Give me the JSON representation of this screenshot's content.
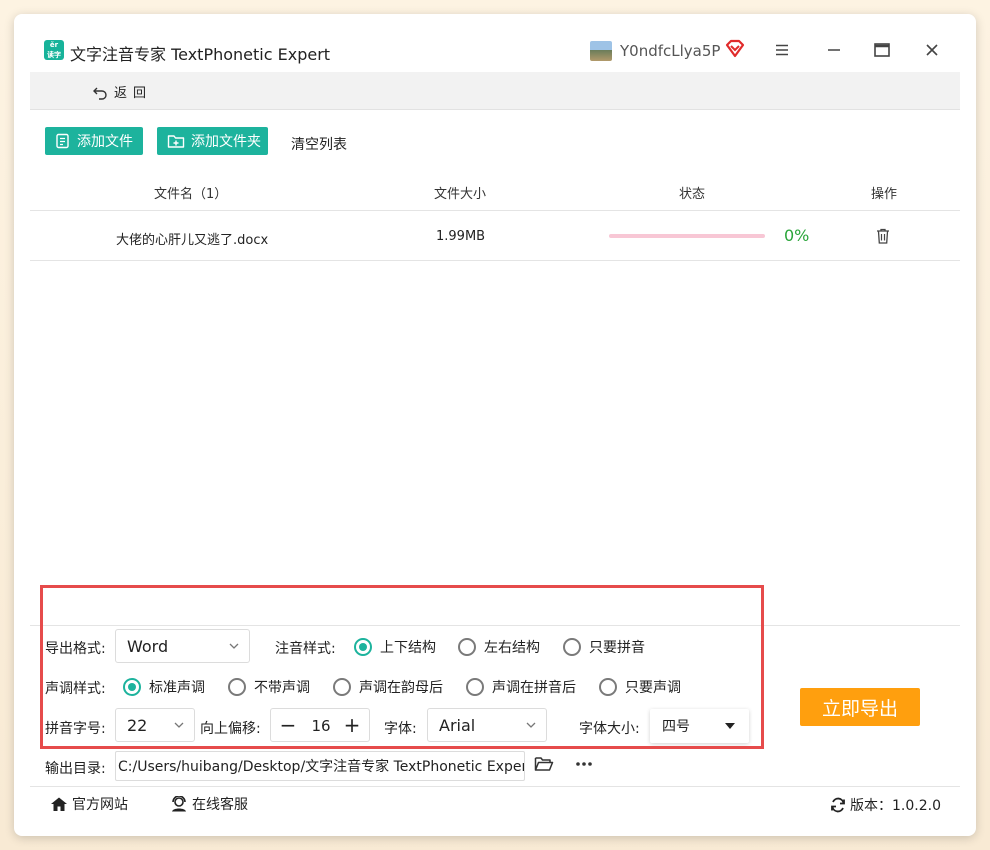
{
  "window": {
    "title": "文字注音专家 TextPhonetic Expert",
    "logo_text": [
      "ěr",
      "读字"
    ],
    "username": "Y0ndfcLlya5P"
  },
  "nav": {
    "back_label": "返回"
  },
  "toolbar": {
    "add_file": "添加文件",
    "add_folder": "添加文件夹",
    "clear_list": "清空列表"
  },
  "table": {
    "headers": {
      "name": "文件名（1）",
      "size": "文件大小",
      "status": "状态",
      "action": "操作"
    },
    "rows": [
      {
        "name": "大佬的心肝儿又逃了.docx",
        "size": "1.99MB",
        "progress": 0,
        "progress_text": "0%"
      }
    ]
  },
  "settings": {
    "export_format_label": "导出格式:",
    "export_format_value": "Word",
    "annotation_style_label": "注音样式:",
    "annotation_options": [
      "上下结构",
      "左右结构",
      "只要拼音"
    ],
    "annotation_selected": 0,
    "tone_style_label": "声调样式:",
    "tone_options": [
      "标准声调",
      "不带声调",
      "声调在韵母后",
      "声调在拼音后",
      "只要声调"
    ],
    "tone_selected": 0,
    "pinyin_size_label": "拼音字号:",
    "pinyin_size_value": "22",
    "offset_label": "向上偏移:",
    "offset_value": "16",
    "font_label": "字体:",
    "font_value": "Arial",
    "font_size_label": "字体大小:",
    "font_size_value": "四号",
    "output_dir_label": "输出目录:",
    "output_dir_value": "C:/Users/huibang/Desktop/文字注音专家 TextPhonetic Expert",
    "export_button": "立即导出"
  },
  "footer": {
    "website": "官方网站",
    "support": "在线客服",
    "version": "版本：1.0.2.0"
  },
  "colors": {
    "accent_green": "#1db39d",
    "export_orange": "#ff9f0e",
    "highlight_red": "#e64b4b",
    "progress_track": "#f8c7d5",
    "percent_green": "#2aa53a"
  }
}
